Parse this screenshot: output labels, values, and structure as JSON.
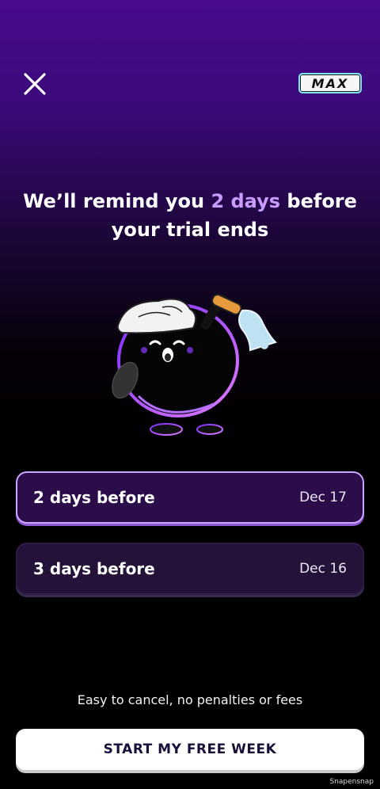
{
  "header": {
    "close_icon": "close-x-icon",
    "badge_label": "MAX",
    "badge_border_color": "#7fe4ef"
  },
  "headline": {
    "part1": "We’ll remind you ",
    "accent": "2 days",
    "part2": " before your trial ends",
    "accent_color": "#c89bff"
  },
  "illustration": {
    "icon": "mascot-ringing-bell-icon"
  },
  "options": [
    {
      "label": "2 days before",
      "date": "Dec 17",
      "selected": true
    },
    {
      "label": "3 days before",
      "date": "Dec 16",
      "selected": false
    }
  ],
  "footer": {
    "note": "Easy to cancel, no penalties or fees",
    "cta_label": "START MY FREE WEEK",
    "watermark": "Snapensnap"
  },
  "colors": {
    "top_gradient": "#4a0a8f",
    "selected_border": "#c9a6ff",
    "cta_text": "#1a0f3a"
  }
}
